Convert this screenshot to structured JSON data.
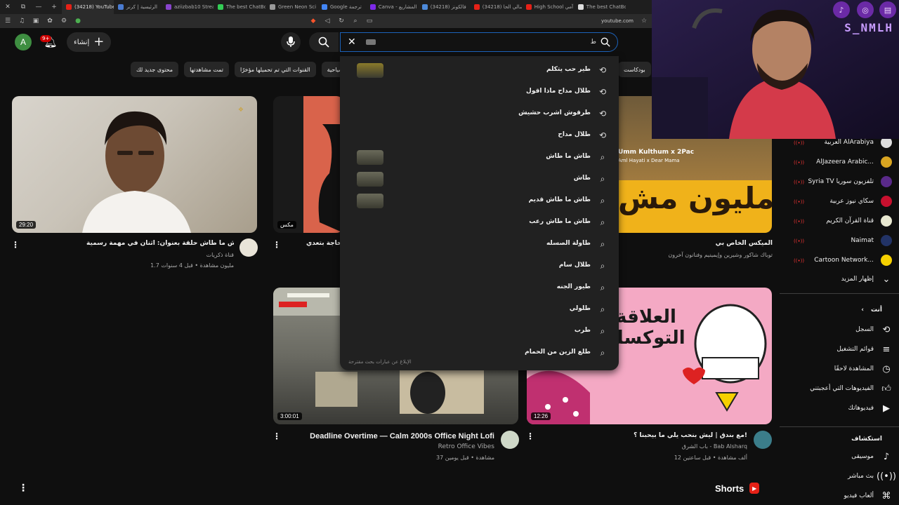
{
  "browser": {
    "tabs": [
      {
        "label": "(34218) YouTube",
        "color": "#e62117",
        "active": true
      },
      {
        "label": "الرئيسية | كرنر",
        "color": "#4a7bd0"
      },
      {
        "label": "aziizbab10 Stream",
        "color": "#8844cc"
      },
      {
        "label": "The best ChatBot",
        "color": "#33cc55"
      },
      {
        "label": "Green Neon Sci",
        "color": "#999999"
      },
      {
        "label": "Google ترجمة",
        "color": "#4285f4"
      },
      {
        "label": "Canva - المشاريع",
        "color": "#7d2ae8"
      },
      {
        "label": "(34218) فالكونز",
        "color": "#4c89d9"
      },
      {
        "label": "(34218) سالي الحا",
        "color": "#e62117"
      },
      {
        "label": "High School آمي",
        "color": "#e62117"
      },
      {
        "label": "The best ChatBot",
        "color": "#dddddd"
      }
    ],
    "url": "youtube.com"
  },
  "masthead": {
    "avatar_letter": "A",
    "notification_count": "9+",
    "create_label": "إنشاء",
    "search": {
      "query": "ط",
      "keyboard_label": "ط"
    }
  },
  "chips": {
    "items": [
      "محتوى جديد لك",
      "تمت مشاهدتها",
      "القنوات التي تم تحميلها مؤخرًا",
      "سياحية"
    ],
    "right": "بودكاست"
  },
  "dropdown": {
    "suggestions": [
      {
        "text": "طير حب يتكلم",
        "icon": "history",
        "thumb": true,
        "thumbColor": "#8a7a2a"
      },
      {
        "text": "طلال مداح ماذا اقول",
        "icon": "history",
        "thumb": false
      },
      {
        "text": "طرقوش اشرب حشيش",
        "icon": "history",
        "thumb": false
      },
      {
        "text": "طلال مداح",
        "icon": "history",
        "thumb": false
      },
      {
        "text": "طاش ما طاش",
        "icon": "search",
        "thumb": true,
        "thumbColor": "#6a6a5a"
      },
      {
        "text": "طاش",
        "icon": "search",
        "thumb": true,
        "thumbColor": "#6a6a5a"
      },
      {
        "text": "طاش ما طاش قديم",
        "icon": "search",
        "thumb": true,
        "thumbColor": "#6a6a5a"
      },
      {
        "text": "طاش ما طاش رعب",
        "icon": "search",
        "thumb": false
      },
      {
        "text": "طاولة الصسله",
        "icon": "search",
        "thumb": false
      },
      {
        "text": "طلال سام",
        "icon": "search",
        "thumb": false
      },
      {
        "text": "طيور الجنه",
        "icon": "search",
        "thumb": false
      },
      {
        "text": "طلولي",
        "icon": "search",
        "thumb": false
      },
      {
        "text": "طرب",
        "icon": "search",
        "thumb": false
      },
      {
        "text": "طلع الزين من الحمام",
        "icon": "search",
        "thumb": false
      }
    ],
    "report_label": "الإبلاغ عن عبارات بحث مقترحة"
  },
  "videos": [
    {
      "title": "طاش ما طاش حلقة بعنوان: اثنان في مهمة رسمية",
      "channel": "قناة ذكريات",
      "meta": "1.7 مليون مشاهدة • قبل 4 سنوات",
      "duration": "29:20"
    },
    {
      "title": "حاجة بتعدي -",
      "channel": "",
      "meta": "",
      "duration": "مكس"
    },
    {
      "title": "الميكس الخاص بي",
      "channel": "توباك شاكور وشيرين وإيمينيم وفنانون آخرون",
      "meta": "",
      "duration": "",
      "thumb_text_top": "Umm Kulthum x 2Pac",
      "thumb_text_sub": "Aml Hayati x Dear Mama",
      "thumb_text_big": "مليون مش"
    },
    {
      "title": "Deadline Overtime — Calm 2000s Office Night Lofi",
      "channel": "Retro Office Vibes",
      "meta": "37 مشاهدة • قبل يومين",
      "duration": "3:00:01"
    },
    {
      "title": "مع بندق | ليش بنحب يلي ما بيحبنا ؟!",
      "channel": "باب الشرق - Bab Alsharq",
      "meta": "12 ألف مشاهدة • قبل ساعتين",
      "duration": "12:26",
      "thumb_text": "العلاقة التوكسك"
    }
  ],
  "sidebar": {
    "channels": [
      {
        "label": "العربية AlArabiya",
        "color": "#dddddd"
      },
      {
        "label": "AlJazeera Arabic...",
        "color": "#d9a521"
      },
      {
        "label": "Syria TV تلفزيون سوريا",
        "color": "#5a2a8a"
      },
      {
        "label": "سكاي نيوز عربية",
        "color": "#c8102e"
      },
      {
        "label": "قناة القرآن الكريم",
        "color": "#e8e8d0"
      },
      {
        "label": "Naimat",
        "color": "#223366"
      },
      {
        "label": "Cartoon Network...",
        "color": "#f5d000"
      }
    ],
    "show_more": "إظهار المزيد",
    "you_header": "أنت",
    "you_items": [
      {
        "label": "السجل",
        "icon": "history"
      },
      {
        "label": "قوائم التشغيل",
        "icon": "playlist"
      },
      {
        "label": "المشاهدة لاحقًا",
        "icon": "clock"
      },
      {
        "label": "الفيديوهات التي أعجبتني",
        "icon": "thumb"
      },
      {
        "label": "فيديوهاتك",
        "icon": "play"
      }
    ],
    "explore_header": "استكشاف",
    "explore_items": [
      {
        "label": "موسيقى",
        "icon": "music"
      },
      {
        "label": "بث مباشر",
        "icon": "live"
      },
      {
        "label": "ألعاب فيديو",
        "icon": "game"
      }
    ]
  },
  "shorts": {
    "title": "Shorts"
  },
  "webcam": {
    "tag": "S_NMLH"
  },
  "colors": {
    "background": "#0f0f0f",
    "accent_red": "#e62117",
    "focus_blue": "#1c62b9"
  }
}
